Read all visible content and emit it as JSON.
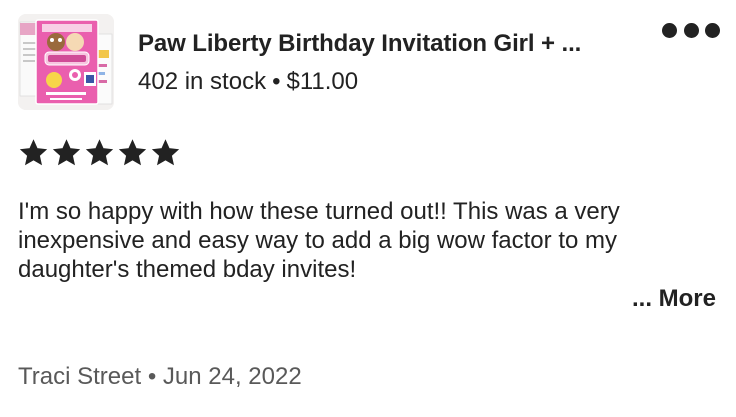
{
  "listing": {
    "title": "Paw Liberty Birthday Invitation Girl + ...",
    "stock": "402 in stock",
    "separator": "•",
    "price": "$11.00",
    "thumbnail_icon": "invitation-product-thumbnail"
  },
  "more_options_icon": "ellipsis-icon",
  "review": {
    "rating": 5,
    "rating_max": 5,
    "star_color": "#222222",
    "text": "I'm so happy with how these turned out!! This was a very inexpensive and easy way to add a big wow factor to my daughter's themed bday invites!",
    "more_label": "... More"
  },
  "reviewer": {
    "name": "Traci Street",
    "separator": "•",
    "date": "Jun 24, 2022"
  }
}
